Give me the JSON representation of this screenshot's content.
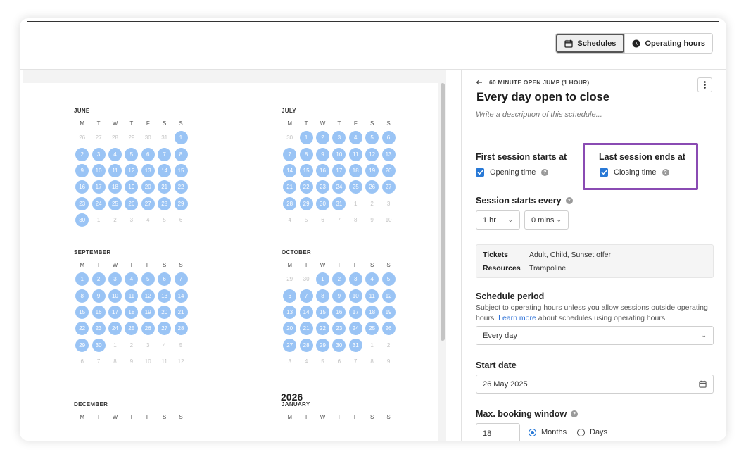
{
  "toolbar": {
    "schedules_label": "Schedules",
    "operating_hours_label": "Operating hours"
  },
  "calendar": {
    "weekdays": [
      "M",
      "T",
      "W",
      "T",
      "F",
      "S",
      "S"
    ],
    "year_label": "2026",
    "months": [
      {
        "name": "JUNE",
        "days": [
          {
            "d": "26",
            "on": false
          },
          {
            "d": "27",
            "on": false
          },
          {
            "d": "28",
            "on": false
          },
          {
            "d": "29",
            "on": false
          },
          {
            "d": "30",
            "on": false
          },
          {
            "d": "31",
            "on": false
          },
          {
            "d": "1",
            "on": true
          },
          {
            "d": "2",
            "on": true
          },
          {
            "d": "3",
            "on": true
          },
          {
            "d": "4",
            "on": true
          },
          {
            "d": "5",
            "on": true
          },
          {
            "d": "6",
            "on": true
          },
          {
            "d": "7",
            "on": true
          },
          {
            "d": "8",
            "on": true
          },
          {
            "d": "9",
            "on": true
          },
          {
            "d": "10",
            "on": true
          },
          {
            "d": "11",
            "on": true
          },
          {
            "d": "12",
            "on": true
          },
          {
            "d": "13",
            "on": true
          },
          {
            "d": "14",
            "on": true
          },
          {
            "d": "15",
            "on": true
          },
          {
            "d": "16",
            "on": true
          },
          {
            "d": "17",
            "on": true
          },
          {
            "d": "18",
            "on": true
          },
          {
            "d": "19",
            "on": true
          },
          {
            "d": "20",
            "on": true
          },
          {
            "d": "21",
            "on": true
          },
          {
            "d": "22",
            "on": true
          },
          {
            "d": "23",
            "on": true
          },
          {
            "d": "24",
            "on": true
          },
          {
            "d": "25",
            "on": true
          },
          {
            "d": "26",
            "on": true
          },
          {
            "d": "27",
            "on": true
          },
          {
            "d": "28",
            "on": true
          },
          {
            "d": "29",
            "on": true
          },
          {
            "d": "30",
            "on": true
          },
          {
            "d": "1",
            "on": false
          },
          {
            "d": "2",
            "on": false
          },
          {
            "d": "3",
            "on": false
          },
          {
            "d": "4",
            "on": false
          },
          {
            "d": "5",
            "on": false
          },
          {
            "d": "6",
            "on": false
          }
        ]
      },
      {
        "name": "JULY",
        "days": [
          {
            "d": "30",
            "on": false
          },
          {
            "d": "1",
            "on": true
          },
          {
            "d": "2",
            "on": true
          },
          {
            "d": "3",
            "on": true
          },
          {
            "d": "4",
            "on": true
          },
          {
            "d": "5",
            "on": true
          },
          {
            "d": "6",
            "on": true
          },
          {
            "d": "7",
            "on": true
          },
          {
            "d": "8",
            "on": true
          },
          {
            "d": "9",
            "on": true
          },
          {
            "d": "10",
            "on": true
          },
          {
            "d": "11",
            "on": true
          },
          {
            "d": "12",
            "on": true
          },
          {
            "d": "13",
            "on": true
          },
          {
            "d": "14",
            "on": true
          },
          {
            "d": "15",
            "on": true
          },
          {
            "d": "16",
            "on": true
          },
          {
            "d": "17",
            "on": true
          },
          {
            "d": "18",
            "on": true
          },
          {
            "d": "19",
            "on": true
          },
          {
            "d": "20",
            "on": true
          },
          {
            "d": "21",
            "on": true
          },
          {
            "d": "22",
            "on": true
          },
          {
            "d": "23",
            "on": true
          },
          {
            "d": "24",
            "on": true
          },
          {
            "d": "25",
            "on": true
          },
          {
            "d": "26",
            "on": true
          },
          {
            "d": "27",
            "on": true
          },
          {
            "d": "28",
            "on": true
          },
          {
            "d": "29",
            "on": true
          },
          {
            "d": "30",
            "on": true
          },
          {
            "d": "31",
            "on": true
          },
          {
            "d": "1",
            "on": false
          },
          {
            "d": "2",
            "on": false
          },
          {
            "d": "3",
            "on": false
          },
          {
            "d": "4",
            "on": false
          },
          {
            "d": "5",
            "on": false
          },
          {
            "d": "6",
            "on": false
          },
          {
            "d": "7",
            "on": false
          },
          {
            "d": "8",
            "on": false
          },
          {
            "d": "9",
            "on": false
          },
          {
            "d": "10",
            "on": false
          }
        ]
      },
      {
        "name": "SEPTEMBER",
        "days": [
          {
            "d": "1",
            "on": true
          },
          {
            "d": "2",
            "on": true
          },
          {
            "d": "3",
            "on": true
          },
          {
            "d": "4",
            "on": true
          },
          {
            "d": "5",
            "on": true
          },
          {
            "d": "6",
            "on": true
          },
          {
            "d": "7",
            "on": true
          },
          {
            "d": "8",
            "on": true
          },
          {
            "d": "9",
            "on": true
          },
          {
            "d": "10",
            "on": true
          },
          {
            "d": "11",
            "on": true
          },
          {
            "d": "12",
            "on": true
          },
          {
            "d": "13",
            "on": true
          },
          {
            "d": "14",
            "on": true
          },
          {
            "d": "15",
            "on": true
          },
          {
            "d": "16",
            "on": true
          },
          {
            "d": "17",
            "on": true
          },
          {
            "d": "18",
            "on": true
          },
          {
            "d": "19",
            "on": true
          },
          {
            "d": "20",
            "on": true
          },
          {
            "d": "21",
            "on": true
          },
          {
            "d": "22",
            "on": true
          },
          {
            "d": "23",
            "on": true
          },
          {
            "d": "24",
            "on": true
          },
          {
            "d": "25",
            "on": true
          },
          {
            "d": "26",
            "on": true
          },
          {
            "d": "27",
            "on": true
          },
          {
            "d": "28",
            "on": true
          },
          {
            "d": "29",
            "on": true
          },
          {
            "d": "30",
            "on": true
          },
          {
            "d": "1",
            "on": false
          },
          {
            "d": "2",
            "on": false
          },
          {
            "d": "3",
            "on": false
          },
          {
            "d": "4",
            "on": false
          },
          {
            "d": "5",
            "on": false
          },
          {
            "d": "6",
            "on": false
          },
          {
            "d": "7",
            "on": false
          },
          {
            "d": "8",
            "on": false
          },
          {
            "d": "9",
            "on": false
          },
          {
            "d": "10",
            "on": false
          },
          {
            "d": "11",
            "on": false
          },
          {
            "d": "12",
            "on": false
          }
        ]
      },
      {
        "name": "OCTOBER",
        "days": [
          {
            "d": "29",
            "on": false
          },
          {
            "d": "30",
            "on": false
          },
          {
            "d": "1",
            "on": true
          },
          {
            "d": "2",
            "on": true
          },
          {
            "d": "3",
            "on": true
          },
          {
            "d": "4",
            "on": true
          },
          {
            "d": "5",
            "on": true
          },
          {
            "d": "6",
            "on": true
          },
          {
            "d": "7",
            "on": true
          },
          {
            "d": "8",
            "on": true
          },
          {
            "d": "9",
            "on": true
          },
          {
            "d": "10",
            "on": true
          },
          {
            "d": "11",
            "on": true
          },
          {
            "d": "12",
            "on": true
          },
          {
            "d": "13",
            "on": true
          },
          {
            "d": "14",
            "on": true
          },
          {
            "d": "15",
            "on": true
          },
          {
            "d": "16",
            "on": true
          },
          {
            "d": "17",
            "on": true
          },
          {
            "d": "18",
            "on": true
          },
          {
            "d": "19",
            "on": true
          },
          {
            "d": "20",
            "on": true
          },
          {
            "d": "21",
            "on": true
          },
          {
            "d": "22",
            "on": true
          },
          {
            "d": "23",
            "on": true
          },
          {
            "d": "24",
            "on": true
          },
          {
            "d": "25",
            "on": true
          },
          {
            "d": "26",
            "on": true
          },
          {
            "d": "27",
            "on": true
          },
          {
            "d": "28",
            "on": true
          },
          {
            "d": "29",
            "on": true
          },
          {
            "d": "30",
            "on": true
          },
          {
            "d": "31",
            "on": true
          },
          {
            "d": "1",
            "on": false
          },
          {
            "d": "2",
            "on": false
          },
          {
            "d": "3",
            "on": false
          },
          {
            "d": "4",
            "on": false
          },
          {
            "d": "5",
            "on": false
          },
          {
            "d": "6",
            "on": false
          },
          {
            "d": "7",
            "on": false
          },
          {
            "d": "8",
            "on": false
          },
          {
            "d": "9",
            "on": false
          }
        ]
      },
      {
        "name": "DECEMBER",
        "days": []
      },
      {
        "name": "JANUARY",
        "days": []
      }
    ]
  },
  "panel": {
    "breadcrumb": "60 MINUTE OPEN JUMP (1 HOUR)",
    "title": "Every day open to close",
    "description_placeholder": "Write a description of this schedule...",
    "first_session_label": "First session starts at",
    "first_session_option": "Opening time",
    "last_session_label": "Last session ends at",
    "last_session_option": "Closing time",
    "session_every_label": "Session starts every",
    "hours_value": "1 hr",
    "mins_value": "0 mins",
    "tickets_key": "Tickets",
    "tickets_value": "Adult, Child, Sunset offer",
    "resources_key": "Resources",
    "resources_value": "Trampoline",
    "schedule_period_label": "Schedule period",
    "schedule_period_help_1": "Subject to operating hours unless you allow sessions outside operating hours.",
    "schedule_period_link": "Learn more",
    "schedule_period_help_2": " about schedules using operating hours.",
    "period_value": "Every day",
    "start_date_label": "Start date",
    "start_date_value": "26 May 2025",
    "max_booking_label": "Max. booking window",
    "max_booking_value": "18",
    "unit_months": "Months",
    "unit_days": "Days"
  },
  "colors": {
    "accent": "#2979d6",
    "active_day": "#9ac4f5",
    "highlight_box": "#8a4bb3"
  }
}
